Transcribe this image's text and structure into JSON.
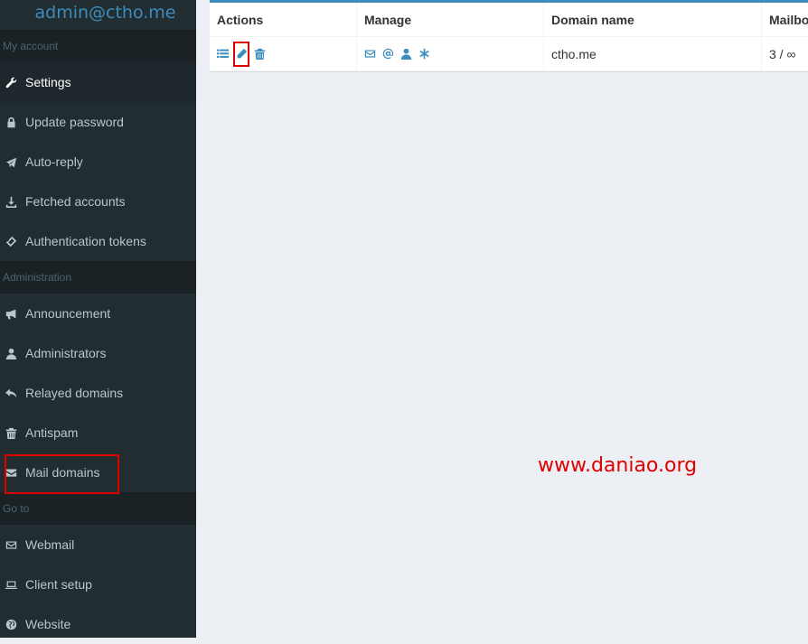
{
  "brand": {
    "title": "admin@ctho.me"
  },
  "sidebar": {
    "my_account_header": "My account",
    "my_account_items": [
      {
        "label": "Settings",
        "icon": "wrench-icon"
      },
      {
        "label": "Update password",
        "icon": "lock-icon"
      },
      {
        "label": "Auto-reply",
        "icon": "plane-icon"
      },
      {
        "label": "Fetched accounts",
        "icon": "download-icon"
      },
      {
        "label": "Authentication tokens",
        "icon": "ticket-icon"
      }
    ],
    "administration_header": "Administration",
    "administration_items": [
      {
        "label": "Announcement",
        "icon": "bullhorn-icon"
      },
      {
        "label": "Administrators",
        "icon": "user-icon"
      },
      {
        "label": "Relayed domains",
        "icon": "reply-icon"
      },
      {
        "label": "Antispam",
        "icon": "trash-icon"
      },
      {
        "label": "Mail domains",
        "icon": "envelope-icon"
      }
    ],
    "goto_header": "Go to",
    "goto_items": [
      {
        "label": "Webmail",
        "icon": "envelope-outline-icon"
      },
      {
        "label": "Client setup",
        "icon": "laptop-icon"
      },
      {
        "label": "Website",
        "icon": "globe-icon"
      }
    ]
  },
  "table": {
    "headers": [
      "Actions",
      "Manage",
      "Domain name",
      "Mailbo"
    ],
    "rows": [
      {
        "domain": "ctho.me",
        "mailboxes": "3 / ∞"
      }
    ]
  },
  "watermark": "www.daniao.org",
  "colors": {
    "accent": "#3c8dbc",
    "sidebar_bg": "#222d32",
    "highlight": "#e00000"
  }
}
